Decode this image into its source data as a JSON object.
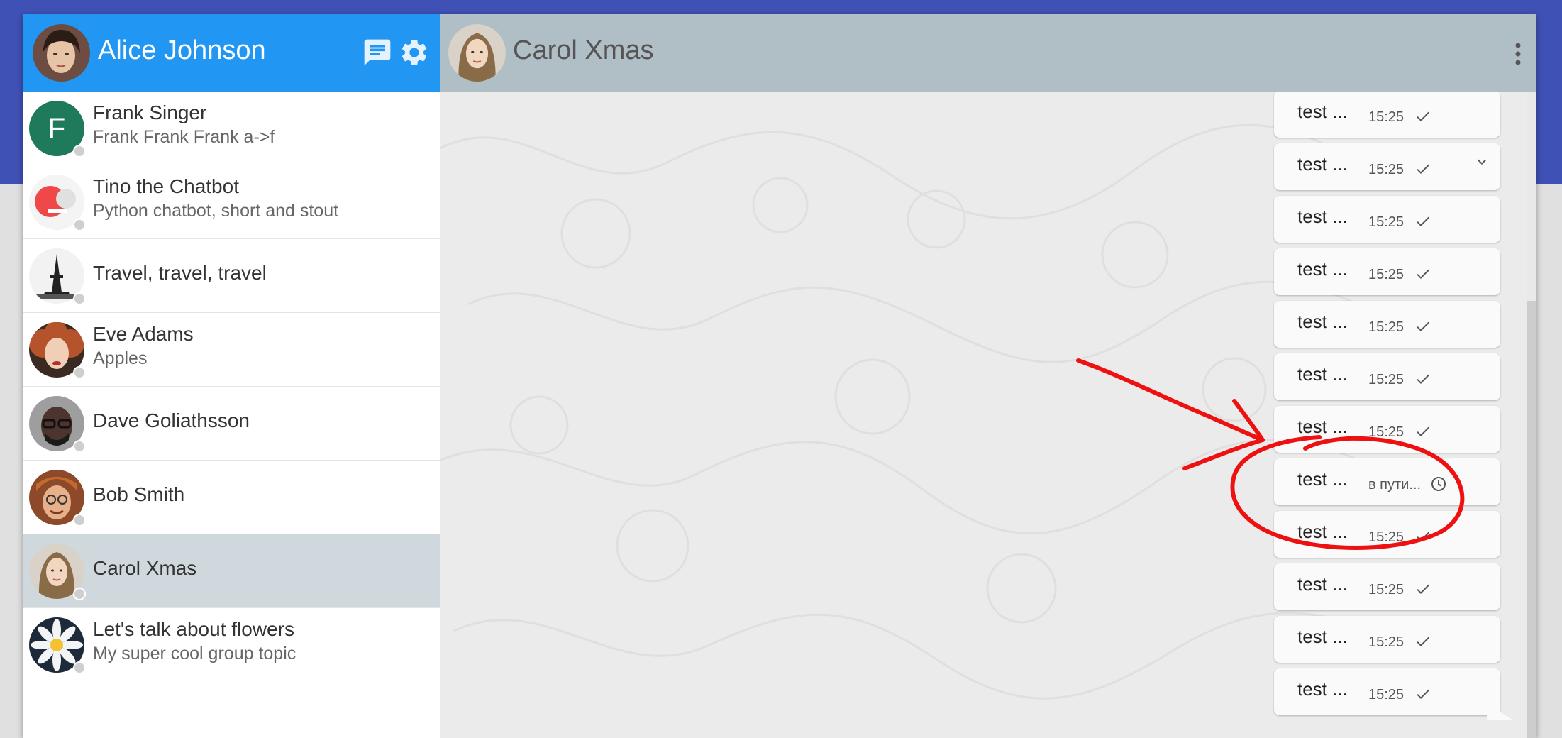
{
  "sidebar": {
    "user_name": "Alice Johnson",
    "contacts": [
      {
        "name": "Frank Singer",
        "subtitle": "Frank Frank Frank a->f",
        "initial": "F"
      },
      {
        "name": "Tino the Chatbot",
        "subtitle": "Python chatbot, short and stout"
      },
      {
        "name": "Travel, travel, travel",
        "subtitle": ""
      },
      {
        "name": "Eve Adams",
        "subtitle": "Apples"
      },
      {
        "name": "Dave Goliathsson",
        "subtitle": ""
      },
      {
        "name": "Bob Smith",
        "subtitle": ""
      },
      {
        "name": "Carol Xmas",
        "subtitle": ""
      },
      {
        "name": "Let's talk about flowers",
        "subtitle": "My super cool group topic"
      }
    ],
    "selected_contact": "Carol Xmas"
  },
  "chat": {
    "peer_name": "Carol Xmas",
    "messages": [
      {
        "text": "test ...",
        "time": "15:25",
        "status": "check-icon"
      },
      {
        "text": "test ...",
        "time": "15:25",
        "status": "check-icon"
      },
      {
        "text": "test ...",
        "time": "15:25",
        "status": "check-icon"
      },
      {
        "text": "test ...",
        "time": "15:25",
        "status": "check-icon"
      },
      {
        "text": "test ...",
        "time": "15:25",
        "status": "check-icon"
      },
      {
        "text": "test ...",
        "time": "15:25",
        "status": "check-icon"
      },
      {
        "text": "test ...",
        "time": "15:25",
        "status": "check-icon"
      },
      {
        "text": "test ...",
        "time": "в пути...",
        "status": "clock-icon"
      },
      {
        "text": "test ...",
        "time": "15:25",
        "status": "check-icon"
      },
      {
        "text": "test ...",
        "time": "15:25",
        "status": "check-icon"
      },
      {
        "text": "test ...",
        "time": "15:25",
        "status": "check-icon"
      },
      {
        "text": "test ...",
        "time": "15:25",
        "status": "check-icon"
      }
    ]
  },
  "colors": {
    "top_band": "#3f51b5",
    "sidebar_header": "#2196f3",
    "chat_header": "#b0bec5",
    "selected_row": "#cfd8dc",
    "annotation": "#ee1111"
  },
  "icons": [
    "new-chat-icon",
    "settings-gear-icon",
    "more-vert-icon",
    "check-icon",
    "clock-icon",
    "chevron-down-icon"
  ]
}
